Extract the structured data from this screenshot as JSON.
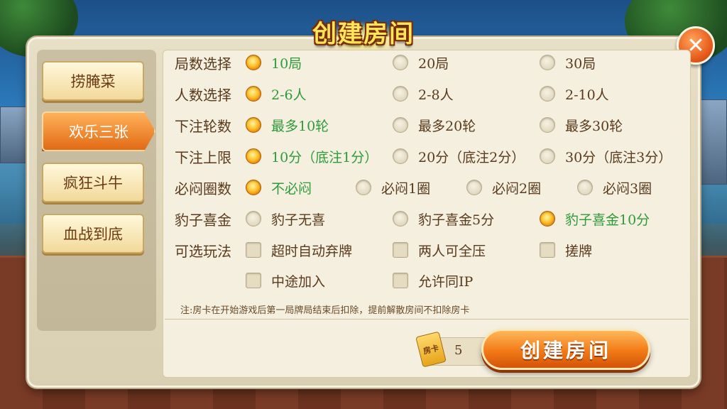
{
  "title": "创建房间",
  "close_label": "✕",
  "tabs": [
    {
      "label": "捞腌菜",
      "active": false
    },
    {
      "label": "欢乐三张",
      "active": true
    },
    {
      "label": "疯狂斗牛",
      "active": false
    },
    {
      "label": "血战到底",
      "active": false
    }
  ],
  "rows": [
    {
      "label": "局数选择",
      "options": [
        {
          "text": "10局",
          "selected": true
        },
        {
          "text": "20局",
          "selected": false
        },
        {
          "text": "30局",
          "selected": false
        }
      ]
    },
    {
      "label": "人数选择",
      "options": [
        {
          "text": "2-6人",
          "selected": true
        },
        {
          "text": "2-8人",
          "selected": false
        },
        {
          "text": "2-10人",
          "selected": false
        }
      ]
    },
    {
      "label": "下注轮数",
      "options": [
        {
          "text": "最多10轮",
          "selected": true
        },
        {
          "text": "最多20轮",
          "selected": false
        },
        {
          "text": "最多30轮",
          "selected": false
        }
      ]
    },
    {
      "label": "下注上限",
      "options": [
        {
          "text": "10分（底注1分）",
          "selected": true
        },
        {
          "text": "20分（底注2分）",
          "selected": false
        },
        {
          "text": "30分（底注3分）",
          "selected": false
        }
      ]
    },
    {
      "label": "必闷圈数",
      "options": [
        {
          "text": "不必闷",
          "selected": true
        },
        {
          "text": "必闷1圈",
          "selected": false
        },
        {
          "text": "必闷2圈",
          "selected": false
        },
        {
          "text": "必闷3圈",
          "selected": false
        }
      ]
    },
    {
      "label": "豹子喜金",
      "options": [
        {
          "text": "豹子无喜",
          "selected": false
        },
        {
          "text": "豹子喜金5分",
          "selected": false
        },
        {
          "text": "豹子喜金10分",
          "selected": true
        }
      ]
    },
    {
      "label": "可选玩法",
      "options": [
        {
          "text": "超时自动弃牌",
          "checked": false
        },
        {
          "text": "两人可全压",
          "checked": false
        },
        {
          "text": "搓牌",
          "checked": false
        }
      ]
    },
    {
      "label": "",
      "options": [
        {
          "text": "中途加入",
          "checked": false
        },
        {
          "text": "允许同IP",
          "checked": false
        }
      ]
    }
  ],
  "note": "注:房卡在开始游戏后第一局牌局结束后扣除，提前解散房间不扣除房卡",
  "room_card": {
    "icon_label": "房卡",
    "count": "5"
  },
  "create_button": "创建房间",
  "colors": {
    "accent": "#f27a16",
    "selected_text": "#2f9a3a",
    "panel": "#f4efde"
  }
}
